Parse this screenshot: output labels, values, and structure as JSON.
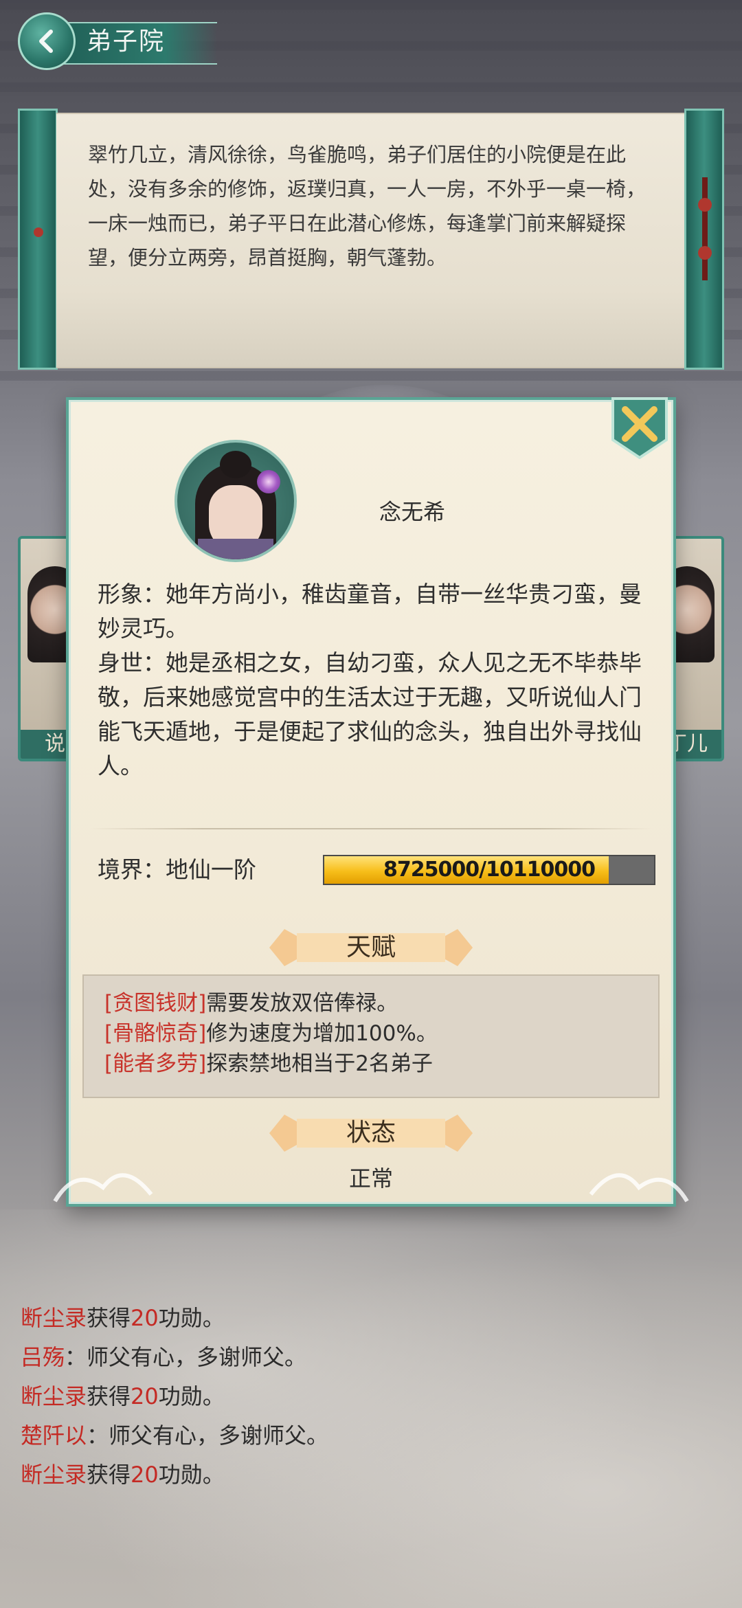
{
  "header": {
    "title": "弟子院"
  },
  "description": "翠竹几立，清风徐徐，鸟雀脆鸣，弟子们居住的小院便是在此处，没有多余的修饰，返璞归真，一人一房，不外乎一桌一椅，一床一烛而已，弟子平日在此潜心修炼，每逢掌门前来解疑探望，便分立两旁，昂首挺胸，朝气蓬勃。",
  "side_cards": {
    "left_tag": "说",
    "right_tag": "丁儿"
  },
  "character": {
    "name": "念无希",
    "appearance": "形象：她年方尚小，稚齿童音，自带一丝华贵刁蛮，曼妙灵巧。",
    "origin": "身世：她是丞相之女，自幼刁蛮，众人见之无不毕恭毕敬，后来她感觉宫中的生活太过于无趣，又听说仙人门能飞天遁地，于是便起了求仙的念头，独自出外寻找仙人。",
    "realm_label": "境界：地仙一阶",
    "xp_text": "8725000/10110000",
    "xp_fraction": 0.863,
    "talent_title": "天赋",
    "talents": [
      {
        "tag": "[贪图钱财]",
        "text": "需要发放双倍俸禄。"
      },
      {
        "tag": "[骨骼惊奇]",
        "text": "修为速度为增加100%。"
      },
      {
        "tag": "[能者多劳]",
        "text": "探索禁地相当于2名弟子"
      }
    ],
    "status_title": "状态",
    "status_value": "正常"
  },
  "log": [
    {
      "who": "断尘录",
      "pre": "获得",
      "num": "20",
      "post": "功勋。"
    },
    {
      "who": "吕殇",
      "pre": "：师父有心，多谢师父。",
      "num": "",
      "post": ""
    },
    {
      "who": "断尘录",
      "pre": "获得",
      "num": "20",
      "post": "功勋。"
    },
    {
      "who": "楚阡以",
      "pre": "：师父有心，多谢师父。",
      "num": "",
      "post": ""
    },
    {
      "who": "断尘录",
      "pre": "获得",
      "num": "20",
      "post": "功勋。"
    }
  ],
  "colors": {
    "accent": "#2d7a6d",
    "highlight_red": "#c8322a",
    "xp_gold": "#f7be1a"
  },
  "icons": {
    "back": "chevron-left-icon",
    "close": "close-x-icon"
  }
}
